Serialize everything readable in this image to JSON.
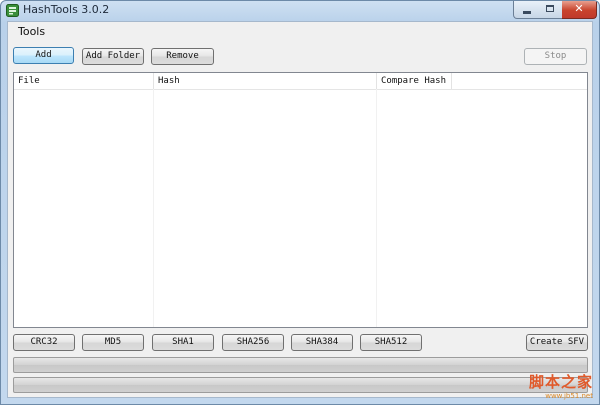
{
  "window": {
    "title": "HashTools 3.0.2",
    "app_icon": "hashtools-app-icon",
    "controls": {
      "minimize_icon": "minimize-icon",
      "maximize_icon": "maximize-icon",
      "close_icon": "close-icon"
    }
  },
  "menu": {
    "items": [
      {
        "label": "Tools"
      }
    ]
  },
  "toolbar": {
    "add_label": "Add",
    "add_folder_label": "Add Folder",
    "remove_label": "Remove",
    "stop_label": "Stop"
  },
  "file_list": {
    "columns": [
      "File",
      "Hash",
      "Compare Hash"
    ],
    "rows": []
  },
  "hash_buttons": {
    "crc32_label": "CRC32",
    "md5_label": "MD5",
    "sha1_label": "SHA1",
    "sha256_label": "SHA256",
    "sha384_label": "SHA384",
    "sha512_label": "SHA512",
    "create_sfv_label": "Create SFV"
  },
  "progress": {
    "file_progress": 0,
    "total_progress": 0
  },
  "watermark": {
    "main": "脚本之家",
    "sub": "www.jb51.net"
  },
  "colors": {
    "accent": "#3c7fb1",
    "close_button": "#c8432c",
    "watermark": "#e05a2b"
  }
}
